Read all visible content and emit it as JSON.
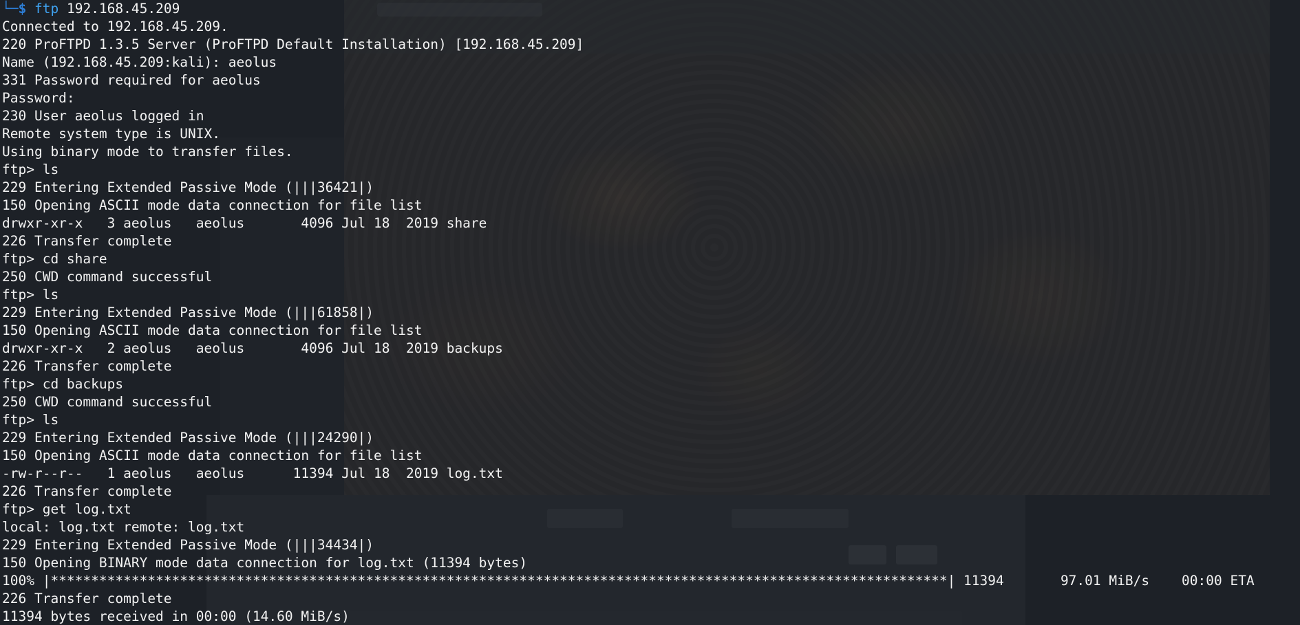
{
  "terminal": {
    "prompt": {
      "corner": "└─",
      "symbol": "$",
      "command": "ftp",
      "argument": "192.168.45.209"
    },
    "lines": [
      "Connected to 192.168.45.209.",
      "220 ProFTPD 1.3.5 Server (ProFTPD Default Installation) [192.168.45.209]",
      "Name (192.168.45.209:kali): aeolus",
      "331 Password required for aeolus",
      "Password:",
      "230 User aeolus logged in",
      "Remote system type is UNIX.",
      "Using binary mode to transfer files.",
      "ftp> ls",
      "229 Entering Extended Passive Mode (|||36421|)",
      "150 Opening ASCII mode data connection for file list",
      "drwxr-xr-x   3 aeolus   aeolus       4096 Jul 18  2019 share",
      "226 Transfer complete",
      "ftp> cd share",
      "250 CWD command successful",
      "ftp> ls",
      "229 Entering Extended Passive Mode (|||61858|)",
      "150 Opening ASCII mode data connection for file list",
      "drwxr-xr-x   2 aeolus   aeolus       4096 Jul 18  2019 backups",
      "226 Transfer complete",
      "ftp> cd backups",
      "250 CWD command successful",
      "ftp> ls",
      "229 Entering Extended Passive Mode (|||24290|)",
      "150 Opening ASCII mode data connection for file list",
      "-rw-r--r--   1 aeolus   aeolus      11394 Jul 18  2019 log.txt",
      "226 Transfer complete",
      "ftp> get log.txt",
      "local: log.txt remote: log.txt",
      "229 Entering Extended Passive Mode (|||34434|)",
      "150 Opening BINARY mode data connection for log.txt (11394 bytes)",
      "100% |***************************************************************************************************************| 11394       97.01 MiB/s    00:00 ETA",
      "226 Transfer complete",
      "11394 bytes received in 00:00 (14.60 MiB/s)"
    ]
  },
  "colors": {
    "background": "#1d2127",
    "text": "#f2f2f2",
    "prompt": "#2d7fd8",
    "command": "#3fa2f0"
  }
}
